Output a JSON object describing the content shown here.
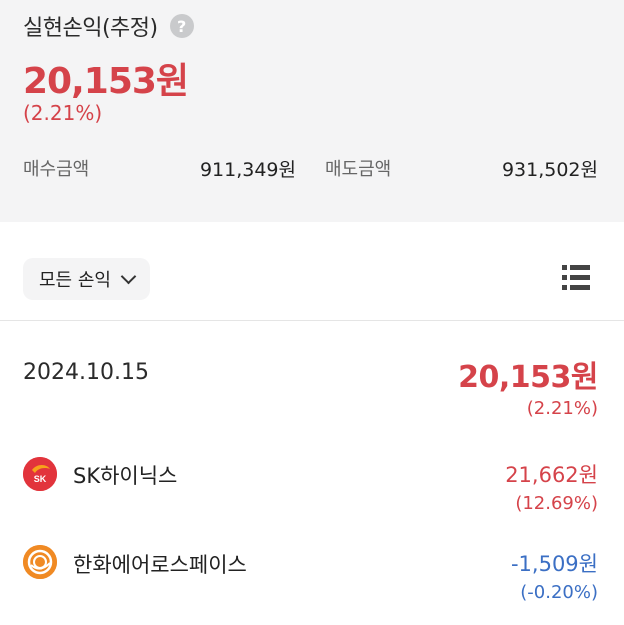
{
  "summary": {
    "title": "실현손익(추정)",
    "help_symbol": "?",
    "total_profit": "20,153원",
    "total_rate": "(2.21%)",
    "buy_label": "매수금액",
    "buy_value": "911,349원",
    "sell_label": "매도금액",
    "sell_value": "931,502원"
  },
  "filter": {
    "label": "모든 손익"
  },
  "day": {
    "date": "2024.10.15",
    "profit": "20,153원",
    "rate": "(2.21%)"
  },
  "stocks": [
    {
      "name": "SK하이닉스",
      "logo_text": "SK",
      "amount": "21,662원",
      "rate": "(12.69%)",
      "trend": "positive",
      "icon": "sk-logo-icon"
    },
    {
      "name": "한화에어로스페이스",
      "amount": "-1,509원",
      "rate": "(-0.20%)",
      "trend": "negative",
      "icon": "hanwha-logo-icon"
    }
  ],
  "colors": {
    "positive": "#d5434a",
    "negative": "#3b6fc4",
    "summary_bg": "#f4f4f5"
  }
}
